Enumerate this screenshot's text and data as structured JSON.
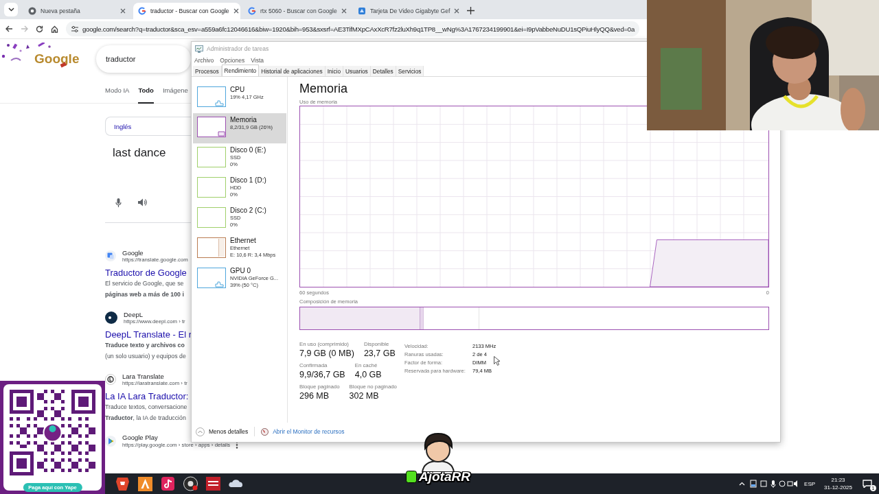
{
  "browser": {
    "tabs": [
      {
        "title": "Nueva pestaña",
        "kind": "chrome",
        "selected": false
      },
      {
        "title": "traductor - Buscar con Google",
        "kind": "google",
        "selected": true
      },
      {
        "title": "rtx 5060 - Buscar con Google",
        "kind": "google",
        "selected": false
      },
      {
        "title": "Tarjeta De Video Gigabyte Gef",
        "kind": "store",
        "selected": false
      }
    ],
    "url": "google.com/search?q=traductor&sca_esv=a559a6fc12046616&biw=1920&bih=953&sxsrf=AE3TifMXpCAxXcR7fz2luXh9q1TP8__wNg%3A1767234199901&ei=I9pVabbeNuDU1sQPiuHlyQQ&ved=0a"
  },
  "google": {
    "logo_text": "Google",
    "query": "traductor",
    "nav": [
      {
        "label": "Modo IA",
        "selected": false
      },
      {
        "label": "Todo",
        "selected": true
      },
      {
        "label": "Imágene",
        "selected": false
      }
    ],
    "translator": {
      "source_language": "Inglés",
      "input_text": "last dance"
    },
    "results": [
      {
        "kind": "translate",
        "source": "Google",
        "url": "https://translate.google.com",
        "title": "Traductor de Google",
        "snippet": [
          {
            "text": "El servicio de Google, que se",
            "bold": false
          },
          {
            "text": "páginas web a más de 100 i",
            "bold": true
          }
        ]
      },
      {
        "kind": "deepl",
        "source": "DeepL",
        "url": "https://www.deepl.com › tr",
        "title": "DeepL Translate - El r",
        "snippet": [
          {
            "text": "Traduce texto y archivos co",
            "bold": true
          },
          {
            "text": "(un solo usuario) y equipos de",
            "bold": false
          }
        ]
      },
      {
        "kind": "lara",
        "source": "Lara Translate",
        "url": "https://laratranslate.com › tr",
        "title": "La IA Lara Traductor:",
        "snippet": [
          {
            "text": "Traduce textos, conversacione",
            "bold": false
          },
          {
            "text": "**Traductor**, la IA de traducción",
            "bold": false
          }
        ]
      },
      {
        "kind": "play",
        "source": "Google Play",
        "url": "https://play.google.com › store › apps › details"
      }
    ]
  },
  "task_manager": {
    "title": "Administrador de tareas",
    "menu": [
      "Archivo",
      "Opciones",
      "Vista"
    ],
    "tabs": [
      {
        "label": "Procesos",
        "selected": false
      },
      {
        "label": "Rendimiento",
        "selected": true
      },
      {
        "label": "Historial de aplicaciones",
        "selected": false
      },
      {
        "label": "Inicio",
        "selected": false
      },
      {
        "label": "Usuarios",
        "selected": false
      },
      {
        "label": "Detalles",
        "selected": false
      },
      {
        "label": "Servicios",
        "selected": false
      }
    ],
    "resources": [
      {
        "kind": "cpu",
        "name": "CPU",
        "lines": [
          "19% 4,17 GHz"
        ],
        "color": "#4ea6dc",
        "selected": false
      },
      {
        "kind": "memory",
        "name": "Memoria",
        "lines": [
          "8,2/31,9 GB (26%)"
        ],
        "color": "#9b4fb0",
        "selected": true
      },
      {
        "kind": "disk",
        "name": "Disco 0 (E:)",
        "lines": [
          "SSD",
          "0%"
        ],
        "color": "#9fcf6a",
        "selected": false
      },
      {
        "kind": "disk",
        "name": "Disco 1 (D:)",
        "lines": [
          "HDD",
          "0%"
        ],
        "color": "#9fcf6a",
        "selected": false
      },
      {
        "kind": "disk",
        "name": "Disco 2 (C:)",
        "lines": [
          "SSD",
          "0%"
        ],
        "color": "#9fcf6a",
        "selected": false
      },
      {
        "kind": "network",
        "name": "Ethernet",
        "lines": [
          "Ethernet",
          "E: 10,6 R: 3,4 Mbps"
        ],
        "color": "#b97b50",
        "selected": false
      },
      {
        "kind": "gpu",
        "name": "GPU 0",
        "lines": [
          "NVIDIA GeForce G...",
          "39% (50 °C)"
        ],
        "color": "#4ea6dc",
        "selected": false
      }
    ],
    "detail": {
      "title": "Memoria",
      "graph_label": "Uso de memoria",
      "time_label": "60 segundos",
      "min_label": "0",
      "composition_label": "Composición de memoria",
      "composition": {
        "level": 0.255
      },
      "stat_rows": [
        [
          {
            "label": "En uso (comprimido)",
            "value": "7,9 GB (0 MB)"
          },
          {
            "label": "Disponible",
            "value": "23,7 GB"
          }
        ],
        [
          {
            "label": "Confirmada",
            "value": "9,9/36,7 GB"
          },
          {
            "label": "En caché",
            "value": "4,0 GB"
          }
        ],
        [
          {
            "label": "Bloque paginado",
            "value": "296 MB"
          },
          {
            "label": "Bloque no paginado",
            "value": "302 MB"
          }
        ]
      ],
      "specs": [
        {
          "label": "Velocidad:",
          "value": "2133 MHz"
        },
        {
          "label": "Ranuras usadas:",
          "value": "2 de 4"
        },
        {
          "label": "Factor de forma:",
          "value": "DIMM"
        },
        {
          "label": "Reservada para hardware:",
          "value": "79,4 MB"
        }
      ]
    },
    "footer": {
      "less_details": "Menos detalles",
      "monitor_link": "Abrir el Monitor de recursos"
    }
  },
  "overlays": {
    "payment_button": "Paga aquí con Yape",
    "streamer_name": "AjotaRR"
  },
  "taskbar": {
    "language": "ESP",
    "time": "21:23",
    "date": "31-12-2025",
    "notifications": "1"
  }
}
